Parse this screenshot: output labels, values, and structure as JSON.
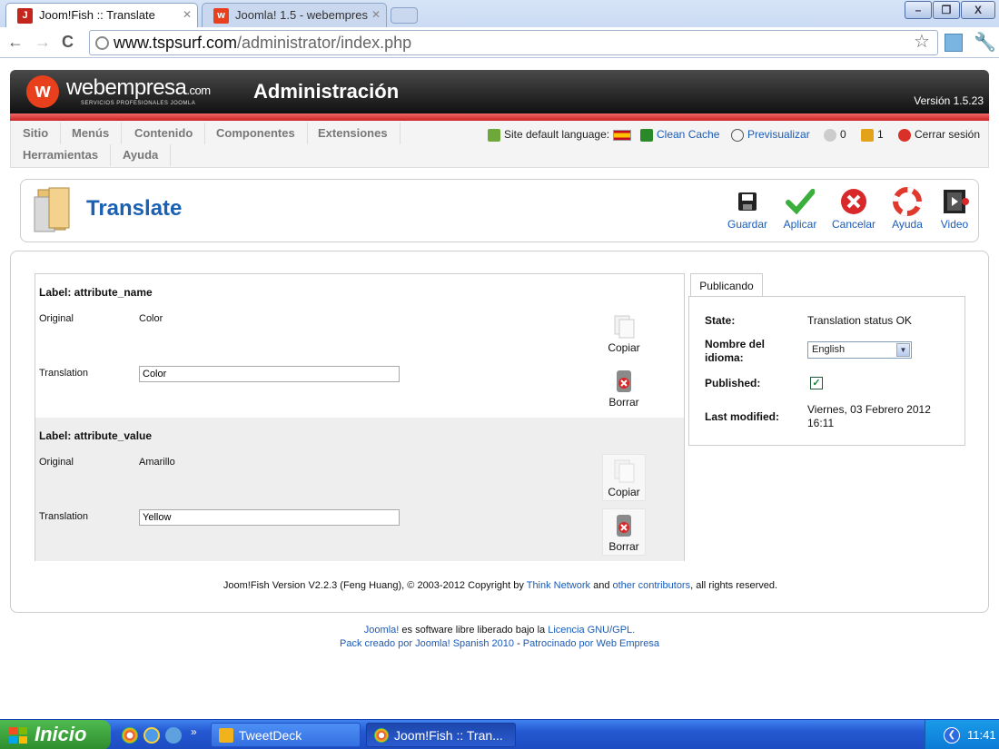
{
  "browser": {
    "tabs": [
      {
        "title": "Joom!Fish :: Translate",
        "active": true
      },
      {
        "title": "Joomla! 1.5 - webempres",
        "active": false
      }
    ],
    "url_host": "www.tspsurf.com",
    "url_path": "/administrator/index.php",
    "window_buttons": {
      "minimize": "–",
      "maximize": "❐",
      "close": "X"
    }
  },
  "header": {
    "logo_text": "webempresa",
    "logo_dotcom": ".com",
    "logo_tagline": "SERVICIOS PROFESIONALES JOOMLA",
    "title": "Administración",
    "version": "Versión 1.5.23"
  },
  "menu": {
    "items": [
      "Sitio",
      "Menús",
      "Contenido",
      "Componentes",
      "Extensiones",
      "Herramientas",
      "Ayuda"
    ]
  },
  "status": {
    "site_language": "Site default language:",
    "clean_cache": "Clean Cache",
    "preview": "Previsualizar",
    "messages_count": "0",
    "users_count": "1",
    "logout": "Cerrar sesión"
  },
  "toolbar": {
    "page_title": "Translate",
    "buttons": [
      "Guardar",
      "Aplicar",
      "Cancelar",
      "Ayuda",
      "Video"
    ]
  },
  "fields": [
    {
      "label": "Label: attribute_name",
      "original_label": "Original",
      "original_value": "Color",
      "translation_label": "Translation",
      "translation_value": "Color",
      "copy_label": "Copiar",
      "delete_label": "Borrar"
    },
    {
      "label": "Label: attribute_value",
      "original_label": "Original",
      "original_value": "Amarillo",
      "translation_label": "Translation",
      "translation_value": "Yellow",
      "copy_label": "Copiar",
      "delete_label": "Borrar"
    }
  ],
  "publishing": {
    "tab_label": "Publicando",
    "state_label": "State:",
    "state_value": "Translation status OK",
    "language_label": "Nombre del idioma:",
    "language_value": "English",
    "published_label": "Published:",
    "published": true,
    "modified_label": "Last modified:",
    "modified_value": "Viernes, 03 Febrero 2012 16:11"
  },
  "fish_footer": {
    "prefix": "Joom!Fish Version V2.2.3 (Feng Huang), © 2003-2012 Copyright by",
    "link1": "Think Network",
    "middle": "and",
    "link2": "other contributors",
    "suffix": ", all rights reserved."
  },
  "site_footer": {
    "line1_link1": "Joomla!",
    "line1_text": "es software libre liberado bajo la",
    "line1_link2": "Licencia GNU/GPL.",
    "line2_text1": "Pack creado por Joomla! Spanish 2010",
    "line2_sep": "-",
    "line2_text2": "Patrocinado por Web Empresa"
  },
  "taskbar": {
    "start_label": "Inicio",
    "quicklaunch_more": "»",
    "tasks": [
      "TweetDeck",
      "Joom!Fish :: Tran..."
    ],
    "clock": "11:41"
  },
  "colors": {
    "accent_link": "#1a5bb8",
    "title_blue": "#1b61b3",
    "header_red": "#e23b3b"
  }
}
